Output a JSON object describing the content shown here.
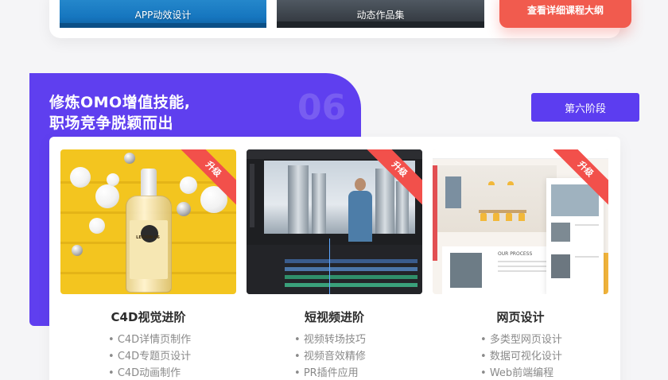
{
  "previous_stage": {
    "thumbs": [
      {
        "label": "APP动效设计"
      },
      {
        "label": "动态作品集"
      }
    ],
    "syllabus_button": "查看详细课程大纲"
  },
  "stage": {
    "headline_line1": "修炼OMO增值技能,",
    "headline_line2": "职场竞争脱颖而出",
    "number": "06",
    "button": "第六阶段"
  },
  "courses": [
    {
      "badge": "升级",
      "title": "C4D视觉进阶",
      "items": [
        "C4D详情页制作",
        "C4D专题页设计",
        "C4D动画制作"
      ]
    },
    {
      "badge": "升级",
      "title": "短视频进阶",
      "items": [
        "视频转场技巧",
        "视频音效精修",
        "PR插件应用"
      ]
    },
    {
      "badge": "升级",
      "title": "网页设计",
      "items": [
        "多类型网页设计",
        "数据可视化设计",
        "Web前端编程"
      ]
    }
  ],
  "image_labels": {
    "bottle_brand": "LEGION 66",
    "web_section": "OUR PROCESS"
  },
  "colors": {
    "primary_purple": "#5f3fef",
    "accent_red": "#f15b4e",
    "badge_red": "#f2504b",
    "c4d_yellow": "#f3c51f"
  }
}
